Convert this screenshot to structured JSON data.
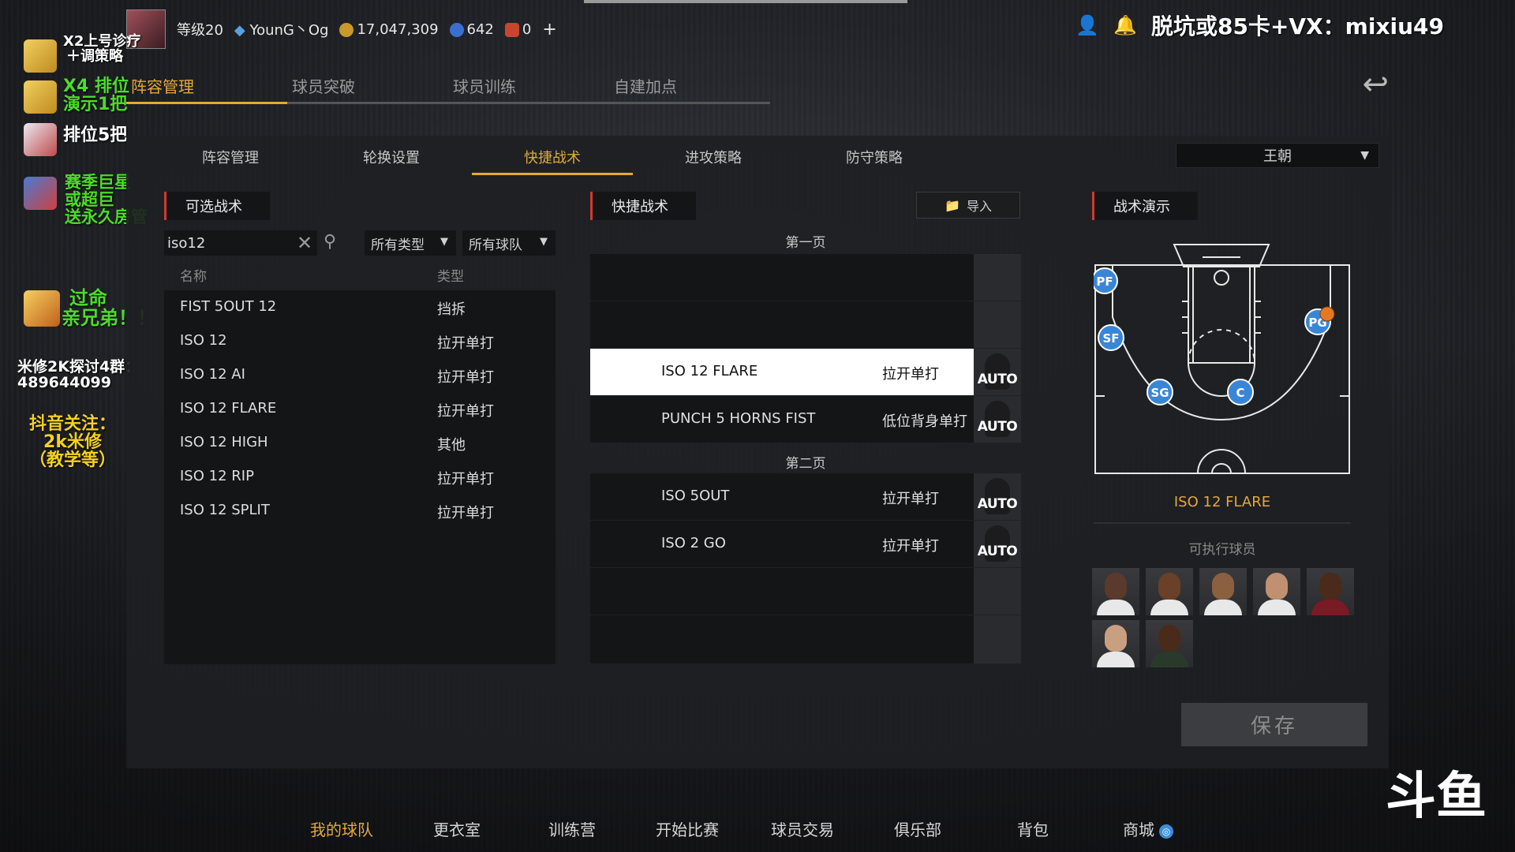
{
  "topbar": {
    "level": "等级20",
    "username": "YounG丶Og",
    "coins": "17,047,309",
    "stars": "642",
    "tokens": "0",
    "plus": "+",
    "promo": "脱坑或85卡+VX：mixiu49"
  },
  "left_promos": {
    "p1": "X2上号诊疗",
    "p1b": "＋调策略",
    "p2": "X4 排位",
    "p2b": "演示1把",
    "p3": "排位5把",
    "p4a": "赛季巨星",
    "p4b": "或超巨",
    "p4c": "送永久房管",
    "p5a": "过命",
    "p5b": "亲兄弟！！",
    "p6a": "米修2K探讨4群：",
    "p6b": "489644099",
    "p7a": "抖音关注：",
    "p7b": "2k米修",
    "p7c": "（教学等）"
  },
  "main_tabs": [
    "阵容管理",
    "球员突破",
    "球员训练",
    "自建加点"
  ],
  "sub_tabs": [
    "阵容管理",
    "轮换设置",
    "快捷战术",
    "进攻策略",
    "防守策略"
  ],
  "team_select": "王朝",
  "available": {
    "title": "可选战术",
    "search_value": "iso12",
    "filter_type": "所有类型",
    "filter_team": "所有球队",
    "col_name": "名称",
    "col_type": "类型",
    "rows": [
      {
        "name": "FIST 5OUT 12",
        "type": "挡拆"
      },
      {
        "name": "ISO 12",
        "type": "拉开单打"
      },
      {
        "name": "ISO 12 AI",
        "type": "拉开单打"
      },
      {
        "name": "ISO 12 FLARE",
        "type": "拉开单打"
      },
      {
        "name": "ISO 12 HIGH",
        "type": "其他"
      },
      {
        "name": "ISO 12 RIP",
        "type": "拉开单打"
      },
      {
        "name": "ISO 12 SPLIT",
        "type": "拉开单打"
      }
    ]
  },
  "quick": {
    "title": "快捷战术",
    "import_label": "导入",
    "page1": "第一页",
    "page2": "第二页",
    "auto": "AUTO",
    "rows1": [
      {
        "name": "",
        "type": ""
      },
      {
        "name": "",
        "type": ""
      },
      {
        "name": "ISO 12 FLARE",
        "type": "拉开单打"
      },
      {
        "name": "PUNCH 5 HORNS FIST",
        "type": "低位背身单打"
      }
    ],
    "rows2": [
      {
        "name": "ISO 5OUT",
        "type": "拉开单打"
      },
      {
        "name": "ISO 2 GO",
        "type": "拉开单打"
      },
      {
        "name": "",
        "type": ""
      },
      {
        "name": "",
        "type": ""
      }
    ]
  },
  "demo": {
    "title": "战术演示",
    "tactic_name": "ISO 12 FLARE",
    "exec_label": "可执行球员",
    "positions": [
      "PF",
      "SF",
      "SG",
      "C",
      "PG"
    ]
  },
  "save_label": "保存",
  "bottom_nav": [
    "我的球队",
    "更衣室",
    "训练营",
    "开始比赛",
    "球员交易",
    "俱乐部",
    "背包",
    "商城"
  ],
  "logo": "斗鱼",
  "colors": {
    "accent": "#e3a93a",
    "section_marker": "#d23a2f",
    "player_marker": "#3a86d6"
  }
}
